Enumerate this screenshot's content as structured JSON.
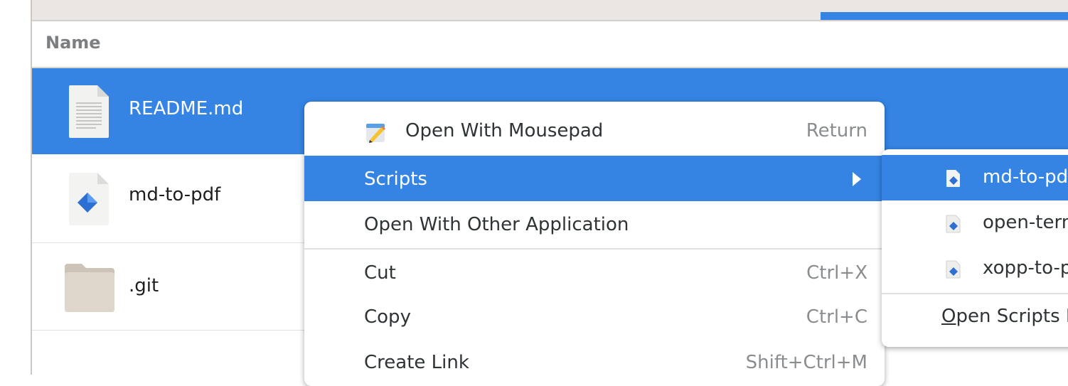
{
  "header": {
    "name_column": "Name"
  },
  "files": [
    {
      "name": "README.md",
      "type": "text-document-icon",
      "selected": true
    },
    {
      "name": "md-to-pdf",
      "type": "script-file-icon",
      "selected": false
    },
    {
      "name": ".git",
      "type": "folder-icon",
      "selected": false
    }
  ],
  "context_menu": {
    "items": [
      {
        "label": "Open With Mousepad",
        "accel": "Return",
        "icon": "mousepad-icon"
      },
      {
        "label": "Scripts",
        "accel": "",
        "submenu": true
      },
      {
        "label": "Open With Other Application",
        "accel": ""
      },
      {
        "label": "Cut",
        "accel": "Ctrl+X"
      },
      {
        "label": "Copy",
        "accel": "Ctrl+C"
      },
      {
        "label": "Create Link",
        "accel": "Shift+Ctrl+M"
      }
    ]
  },
  "scripts_submenu": {
    "items": [
      {
        "label": "md-to-pdf",
        "icon": "script-file-icon"
      },
      {
        "label": "open-terminal",
        "icon": "script-file-icon"
      },
      {
        "label": "xopp-to-pdf",
        "icon": "script-file-icon"
      },
      {
        "label": "Open Scripts Folder",
        "mnemonic": "O",
        "rest": "pen Scripts Folder"
      }
    ]
  },
  "colors": {
    "accent": "#3584e4",
    "background": "#ffffff"
  }
}
